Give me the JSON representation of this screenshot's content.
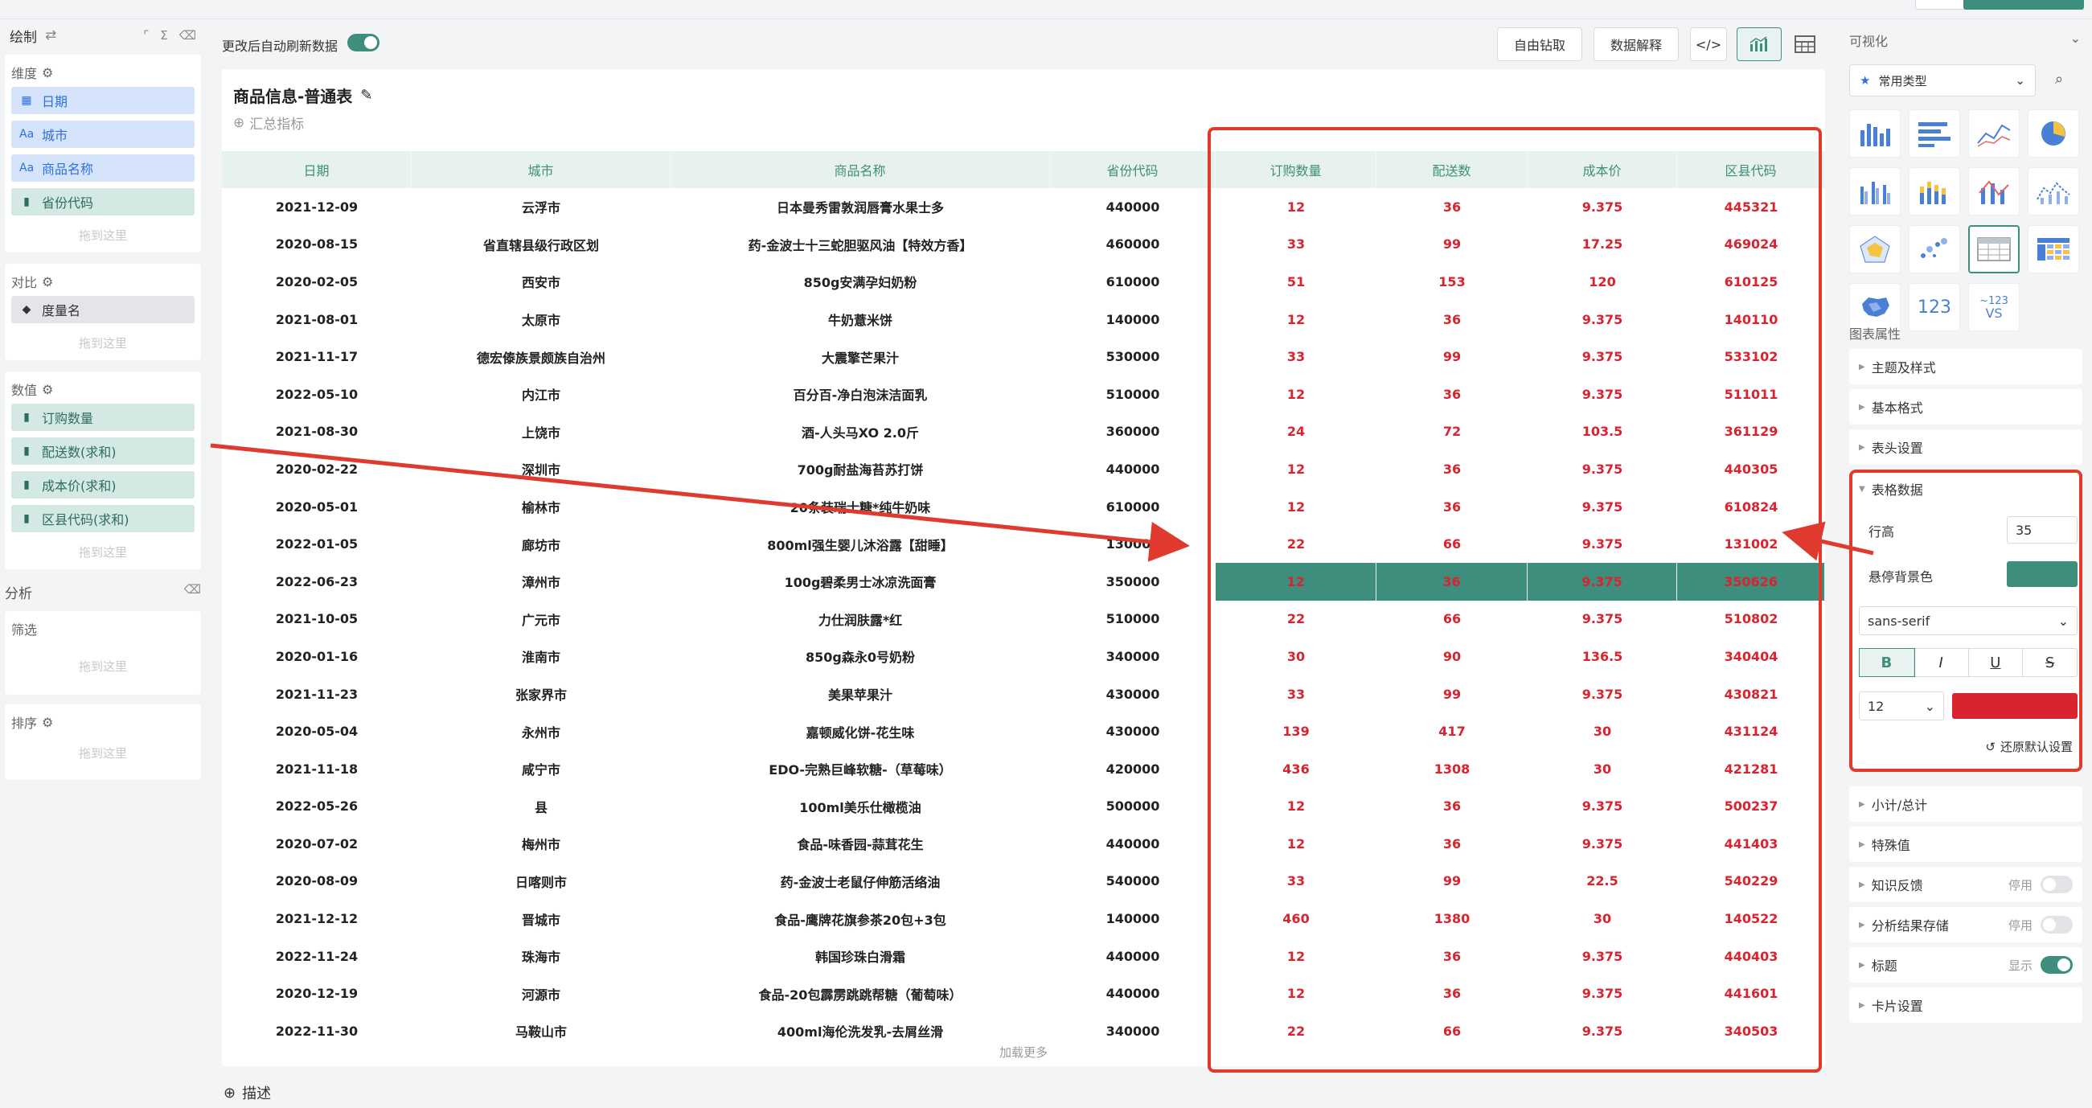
{
  "left_panel": {
    "title": "绘制",
    "dimension": {
      "title": "维度",
      "items": [
        {
          "icon": "calendar-icon",
          "label": "日期"
        },
        {
          "icon": "text-icon",
          "label": "城市"
        },
        {
          "icon": "text-icon",
          "label": "商品名称"
        },
        {
          "icon": "bar-icon",
          "label": "省份代码"
        }
      ],
      "drop": "拖到这里"
    },
    "compare": {
      "title": "对比",
      "items": [
        {
          "icon": "tag-icon",
          "label": "度量名"
        }
      ],
      "drop": "拖到这里"
    },
    "measure": {
      "title": "数值",
      "items": [
        {
          "icon": "bar-icon",
          "label": "订购数量"
        },
        {
          "icon": "bar-icon",
          "label": "配送数(求和)"
        },
        {
          "icon": "bar-icon",
          "label": "成本价(求和)"
        },
        {
          "icon": "bar-icon",
          "label": "区县代码(求和)"
        }
      ],
      "drop": "拖到这里"
    },
    "analysis": "分析",
    "filter": {
      "title": "筛选",
      "drop": "拖到这里"
    },
    "sort": {
      "title": "排序",
      "drop": "拖到这里"
    }
  },
  "toolbar": {
    "auto_refresh": "更改后自动刷新数据",
    "drill": "自由钻取",
    "explain": "数据解释",
    "code_icon": "code-icon",
    "chart_icon": "chart-icon",
    "table_icon": "table-icon"
  },
  "card": {
    "title": "商品信息-普通表",
    "add_metric": "汇总指标",
    "load_more": "加载更多",
    "describe": "描述"
  },
  "table": {
    "columns": [
      "日期",
      "城市",
      "商品名称",
      "省份代码",
      "订购数量",
      "配送数",
      "成本价",
      "区县代码"
    ],
    "rows": [
      [
        "2021-12-09",
        "云浮市",
        "日本曼秀雷敦润唇膏水果士多",
        "440000",
        "12",
        "36",
        "9.375",
        "445321"
      ],
      [
        "2020-08-15",
        "省直辖县级行政区划",
        "药-金波士十三蛇胆驱风油【特效方香】",
        "460000",
        "33",
        "99",
        "17.25",
        "469024"
      ],
      [
        "2020-02-05",
        "西安市",
        "850g安满孕妇奶粉",
        "610000",
        "51",
        "153",
        "120",
        "610125"
      ],
      [
        "2021-08-01",
        "太原市",
        "牛奶薏米饼",
        "140000",
        "12",
        "36",
        "9.375",
        "140110"
      ],
      [
        "2021-11-17",
        "德宏傣族景颇族自治州",
        "大震擎芒果汁",
        "530000",
        "33",
        "99",
        "9.375",
        "533102"
      ],
      [
        "2022-05-10",
        "内江市",
        "百分百-净白泡沫洁面乳",
        "510000",
        "12",
        "36",
        "9.375",
        "511011"
      ],
      [
        "2021-08-30",
        "上饶市",
        "酒-人头马XO 2.0斤",
        "360000",
        "24",
        "72",
        "103.5",
        "361129"
      ],
      [
        "2020-02-22",
        "深圳市",
        "700g耐盐海苔苏打饼",
        "440000",
        "12",
        "36",
        "9.375",
        "440305"
      ],
      [
        "2020-05-01",
        "榆林市",
        "20条装瑞士糖*纯牛奶味",
        "610000",
        "12",
        "36",
        "9.375",
        "610824"
      ],
      [
        "2022-01-05",
        "廊坊市",
        "800ml强生婴儿沐浴露【甜睡】",
        "130000",
        "22",
        "66",
        "9.375",
        "131002"
      ],
      [
        "2022-06-23",
        "漳州市",
        "100g碧柔男士冰凉洗面膏",
        "350000",
        "12",
        "36",
        "9.375",
        "350626"
      ],
      [
        "2021-10-05",
        "广元市",
        "力仕润肤露*红",
        "510000",
        "22",
        "66",
        "9.375",
        "510802"
      ],
      [
        "2020-01-16",
        "淮南市",
        "850g森永0号奶粉",
        "340000",
        "30",
        "90",
        "136.5",
        "340404"
      ],
      [
        "2021-11-23",
        "张家界市",
        "美果苹果汁",
        "430000",
        "33",
        "99",
        "9.375",
        "430821"
      ],
      [
        "2020-05-04",
        "永州市",
        "嘉顿威化饼-花生味",
        "430000",
        "139",
        "417",
        "30",
        "431124"
      ],
      [
        "2021-11-18",
        "咸宁市",
        "EDO-完熟巨峰软糖-（草莓味）",
        "420000",
        "436",
        "1308",
        "30",
        "421281"
      ],
      [
        "2022-05-26",
        "县",
        "100ml美乐仕橄榄油",
        "500000",
        "12",
        "36",
        "9.375",
        "500237"
      ],
      [
        "2020-07-02",
        "梅州市",
        "食品-味香园-蒜茸花生",
        "440000",
        "12",
        "36",
        "9.375",
        "441403"
      ],
      [
        "2020-08-09",
        "日喀则市",
        "药-金波士老鼠仔伸筋活络油",
        "540000",
        "33",
        "99",
        "22.5",
        "540229"
      ],
      [
        "2021-12-12",
        "晋城市",
        "食品-鹰牌花旗参茶20包+3包",
        "140000",
        "460",
        "1380",
        "30",
        "140522"
      ],
      [
        "2022-11-24",
        "珠海市",
        "韩国珍珠白滑霜",
        "440000",
        "12",
        "36",
        "9.375",
        "440403"
      ],
      [
        "2020-12-19",
        "河源市",
        "食品-20包霹雳跳跳帮糖（葡萄味）",
        "440000",
        "12",
        "36",
        "9.375",
        "441601"
      ],
      [
        "2022-11-30",
        "马鞍山市",
        "400ml海伦洗发乳-去屑丝滑",
        "340000",
        "22",
        "66",
        "9.375",
        "340503"
      ]
    ],
    "hover_row": 10
  },
  "right_panel": {
    "title": "可视化",
    "chart_type": "常用类型",
    "grid_icons": [
      "bar-chart-icon",
      "horizontal-bar-icon",
      "line-chart-icon",
      "pie-chart-icon",
      "grouped-bar-icon",
      "stacked-bar-icon",
      "combo-chart-icon",
      "area-chart-icon",
      "radar-chart-icon",
      "scatter-chart-icon",
      "table-chart-icon",
      "pivot-table-icon",
      "map-chart-icon",
      "number-card-icon",
      "compare-card-icon"
    ],
    "number_card": "123",
    "compare_card_top": "~123",
    "compare_card_bottom": "VS",
    "props_title": "图表属性",
    "sections": [
      {
        "label": "主题及样式"
      },
      {
        "label": "基本格式"
      },
      {
        "label": "表头设置"
      }
    ],
    "table_data": {
      "title": "表格数据",
      "row_height_label": "行高",
      "row_height": "35",
      "hover_bg_label": "悬停背景色",
      "font": "sans-serif",
      "bold": "B",
      "italic": "I",
      "underline": "U",
      "strike": "S",
      "font_size": "12",
      "reset": "还原默认设置"
    },
    "sections2": [
      {
        "label": "小计/总计",
        "status": ""
      },
      {
        "label": "特殊值",
        "status": ""
      },
      {
        "label": "知识反馈",
        "status": "停用"
      },
      {
        "label": "分析结果存储",
        "status": "停用"
      },
      {
        "label": "标题",
        "status": "显示"
      },
      {
        "label": "卡片设置",
        "status": ""
      }
    ]
  },
  "colors": {
    "accent": "#3e8e7e",
    "highlight": "#d9232e",
    "annotation": "#e03a2f"
  }
}
